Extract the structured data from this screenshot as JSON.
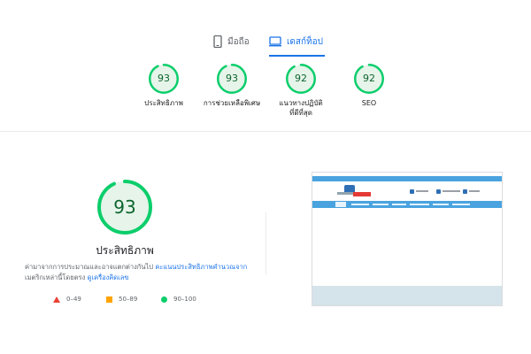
{
  "tabs": [
    {
      "label": "มือถือ",
      "icon": "mobile-phone-icon",
      "active": false
    },
    {
      "label": "เดสก์ท็อป",
      "icon": "desktop-monitor-icon",
      "active": true
    }
  ],
  "categories": [
    {
      "score": "93",
      "label": "ประสิทธิภาพ",
      "score_fraction": 0.93
    },
    {
      "score": "93",
      "label": "การช่วยเหลือพิเศษ",
      "score_fraction": 0.93
    },
    {
      "score": "92",
      "label": "แนวทางปฏิบัติที่ดีที่สุด",
      "score_fraction": 0.92
    },
    {
      "score": "92",
      "label": "SEO",
      "score_fraction": 0.92
    }
  ],
  "main": {
    "score": "93",
    "score_fraction": 0.93,
    "title": "ประสิทธิภาพ",
    "description_text": "ค่ามาจากการประมาณและอาจแตกต่างกันไป ",
    "description_link1": "คะแนนประสิทธิภาพคำนวณจาก",
    "description_text2": "เมตริกเหล่านี้โดยตรง ",
    "description_link2": "ดูเครื่องคิดเลข"
  },
  "legend": [
    {
      "range": "0–49",
      "shape": "triangle",
      "color": "#ea4335"
    },
    {
      "range": "50–89",
      "shape": "square",
      "color": "#ffa400"
    },
    {
      "range": "90–100",
      "shape": "circle",
      "color": "#0cce6b"
    }
  ],
  "colors": {
    "pass": "#0cce6b",
    "pass_text": "#0d652d",
    "pass_fill": "#e6f4ea",
    "accent": "#1a73e8"
  }
}
